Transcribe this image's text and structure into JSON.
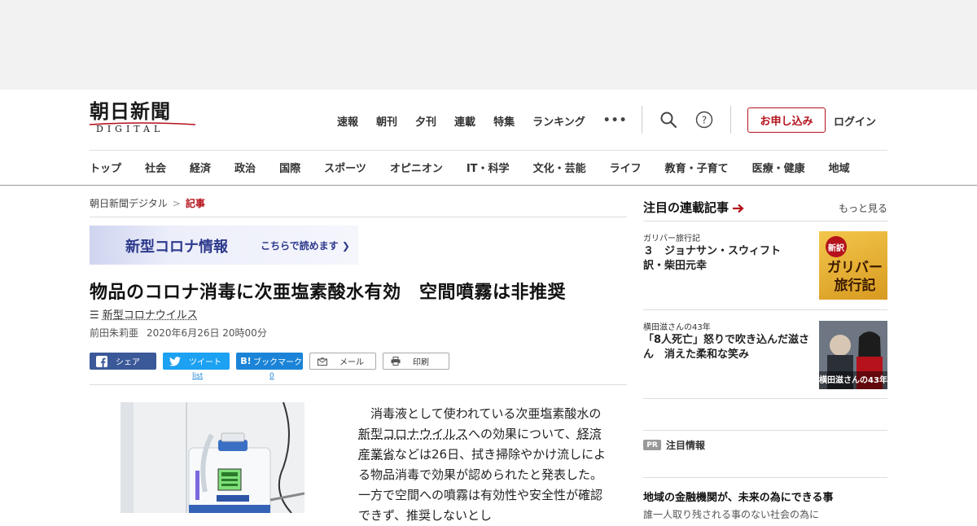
{
  "header": {
    "logo_main": "朝日新聞",
    "logo_sub": "DIGITAL",
    "top_nav": [
      "速報",
      "朝刊",
      "夕刊",
      "連載",
      "特集",
      "ランキング"
    ],
    "more": "•••",
    "subscribe": "お申し込み",
    "login": "ログイン",
    "categories": [
      "トップ",
      "社会",
      "経済",
      "政治",
      "国際",
      "スポーツ",
      "オピニオン",
      "IT・科学",
      "文化・芸能",
      "ライフ",
      "教育・子育て",
      "医療・健康",
      "地域"
    ]
  },
  "breadcrumb": {
    "home": "朝日新聞デジタル",
    "sep": ">",
    "current": "記事"
  },
  "banner": {
    "title": "新型コロナ情報",
    "link": "こちらで読めます"
  },
  "article": {
    "headline": "物品のコロナ消毒に次亜塩素酸水有効　空間噴霧は非推奨",
    "topic": "新型コロナウイルス",
    "author": "前田朱莉亜",
    "date": "2020年6月26日 20時00分",
    "share": {
      "facebook": "シェア",
      "twitter": "ツイート",
      "twitter_count": "list",
      "hatena": "ブックマーク",
      "hatena_prefix": "B!",
      "hatena_count": "0",
      "mail": "メール",
      "print": "印刷"
    },
    "body_1": "消毒液として使われている次亜塩素酸水の",
    "body_link_1": "新型コロナウイルス",
    "body_2": "への効果について、",
    "body_link_2": "経済産業省",
    "body_3": "などは26日、拭き掃除やかけ流しによる物品消毒で効果が認められたと発表した。一方で空間への噴霧は有効性や安全性が確認できず、推奨しないとし"
  },
  "sidebar": {
    "heading": "注目の連載記事",
    "more": "もっと見る",
    "cards": [
      {
        "kicker": "ガリバー旅行記",
        "title": "３　ジョナサン・スウィフト　訳・柴田元幸",
        "img_badge": "新訳",
        "img_text_1": "ガリバー",
        "img_text_2": "旅行記"
      },
      {
        "kicker": "横田滋さんの43年",
        "title": "「8人死亡」怒りで吹き込んだ滋さん　消えた柔和な笑み",
        "img_text": "横田滋さんの43年"
      }
    ],
    "pr_badge": "PR",
    "pr_label": "注目情報",
    "pr_item": "地域の金融機関が、未来の為にできる事",
    "pr_cut": "誰一人取り残される事のない社会の為に"
  },
  "colors": {
    "brand_red": "#b5121b",
    "facebook": "#3b5998",
    "twitter": "#1da1f2",
    "hatena": "#1b84d8"
  }
}
